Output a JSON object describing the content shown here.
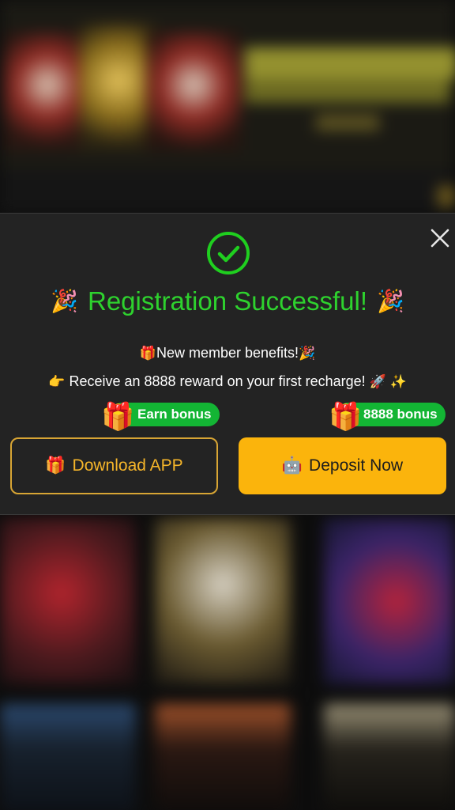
{
  "modal": {
    "title": "Registration Successful!",
    "benefits_line": "New member benefits!",
    "reward_line": "Receive an 8888 reward on your first recharge!",
    "close_icon": "close-icon",
    "status_icon": "check-circle-icon",
    "title_emoji_left": "🎉",
    "title_emoji_right": "🎉",
    "benefits_emoji_before": "🎁",
    "benefits_emoji_after": "🎉",
    "reward_emoji_before": "👉",
    "reward_emoji_after": "🚀 ✨"
  },
  "buttons": {
    "download_label": "Download APP",
    "download_icon": "🎁",
    "deposit_label": "Deposit Now",
    "deposit_icon": "🤖"
  },
  "badges": {
    "earn_label": "Earn bonus",
    "bonus_label": "8888 bonus",
    "gift_icon": "🎁"
  },
  "colors": {
    "accent_green": "#2ed22e",
    "badge_green": "#13b534",
    "gold": "#fbb40c",
    "modal_bg": "#232323"
  }
}
